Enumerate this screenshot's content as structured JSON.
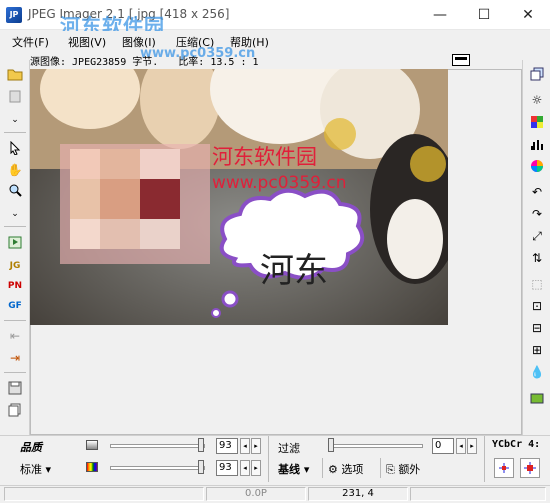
{
  "window": {
    "title": "JPEG Imager 2.1 [.jpg [418 x 256]",
    "watermark": "河东软件园",
    "watermark_url": "www.pc0359.cn",
    "minimize": "—",
    "maximize": "☐",
    "close": "✕"
  },
  "menu": {
    "items": [
      "文件(F)",
      "视图(V)",
      "图像(I)",
      "压缩(C)",
      "帮助(H)"
    ]
  },
  "info": {
    "label": "源图像: JPEG23859 字节.",
    "ratio": "比率: 13.5 : 1"
  },
  "image": {
    "overlay_title": "河东软件园",
    "overlay_url": "www.pc0359.cn",
    "bubble_text": "河东"
  },
  "bottom": {
    "quality_label": "品质",
    "preset_label": "标准",
    "q1_value": "93",
    "q2_value": "93",
    "filter_label": "过滤",
    "filter_value": "0",
    "baseline_label": "基线",
    "options_label": "选项",
    "extra_label": "额外",
    "colorspace_label": "YCbCr 4:"
  },
  "status": {
    "zoom": "0.0P",
    "coords": "231, 4"
  },
  "colors": {
    "watermark": "#3c96e6",
    "overlay_text": "#e0203a",
    "bubble_border": "#8a4fc6"
  }
}
